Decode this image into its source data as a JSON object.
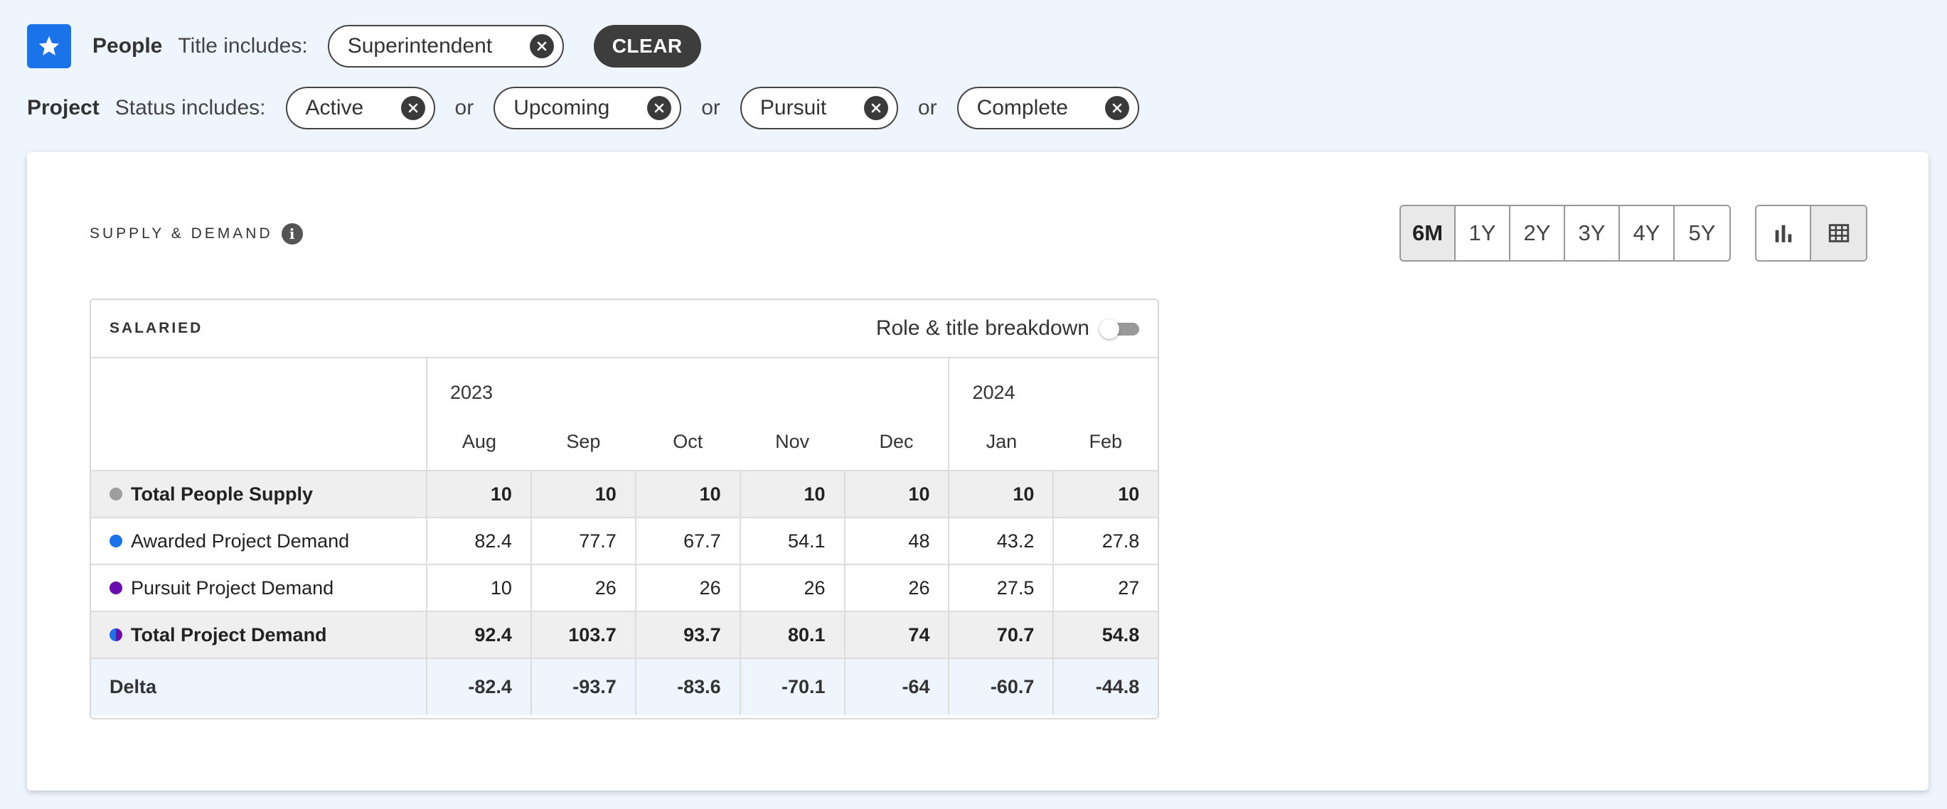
{
  "filters": {
    "people": {
      "label": "People",
      "condition": "Title includes:",
      "chips": [
        "Superintendent"
      ],
      "clear_label": "CLEAR"
    },
    "project": {
      "label": "Project",
      "condition": "Status includes:",
      "chips": [
        "Active",
        "Upcoming",
        "Pursuit",
        "Complete"
      ],
      "separator": "or"
    }
  },
  "panel": {
    "title": "SUPPLY & DEMAND",
    "ranges": [
      "6M",
      "1Y",
      "2Y",
      "3Y",
      "4Y",
      "5Y"
    ],
    "active_range": "6M",
    "views": [
      "bar-chart-icon",
      "table-icon"
    ],
    "active_view": "table-icon"
  },
  "table": {
    "title": "SALARIED",
    "toggle_label": "Role & title breakdown",
    "toggle_on": false,
    "years": [
      {
        "label": "2023",
        "span": 5
      },
      {
        "label": "2024",
        "span": 2
      }
    ],
    "months": [
      "Aug",
      "Sep",
      "Oct",
      "Nov",
      "Dec",
      "Jan",
      "Feb"
    ],
    "rows": [
      {
        "label": "Total People Supply",
        "dot": "#9e9e9e",
        "style": "shade",
        "values": [
          "10",
          "10",
          "10",
          "10",
          "10",
          "10",
          "10"
        ]
      },
      {
        "label": "Awarded Project Demand",
        "dot": "#1a73e8",
        "style": "plain",
        "values": [
          "82.4",
          "77.7",
          "67.7",
          "54.1",
          "48",
          "43.2",
          "27.8"
        ]
      },
      {
        "label": "Pursuit Project Demand",
        "dot": "#6a0dad",
        "style": "plain",
        "values": [
          "10",
          "26",
          "26",
          "26",
          "26",
          "27.5",
          "27"
        ]
      },
      {
        "label": "Total Project Demand",
        "dot": "split",
        "style": "shade",
        "values": [
          "92.4",
          "103.7",
          "93.7",
          "80.1",
          "74",
          "70.7",
          "54.8"
        ]
      },
      {
        "label": "Delta",
        "dot": "",
        "style": "delta",
        "values": [
          "-82.4",
          "-93.7",
          "-83.6",
          "-70.1",
          "-64",
          "-60.7",
          "-44.8"
        ]
      }
    ]
  },
  "colors": {
    "accent": "#1a73e8",
    "background": "#eef5fd",
    "supply_dot": "#9e9e9e",
    "awarded_dot": "#1a73e8",
    "pursuit_dot": "#6a0dad"
  }
}
